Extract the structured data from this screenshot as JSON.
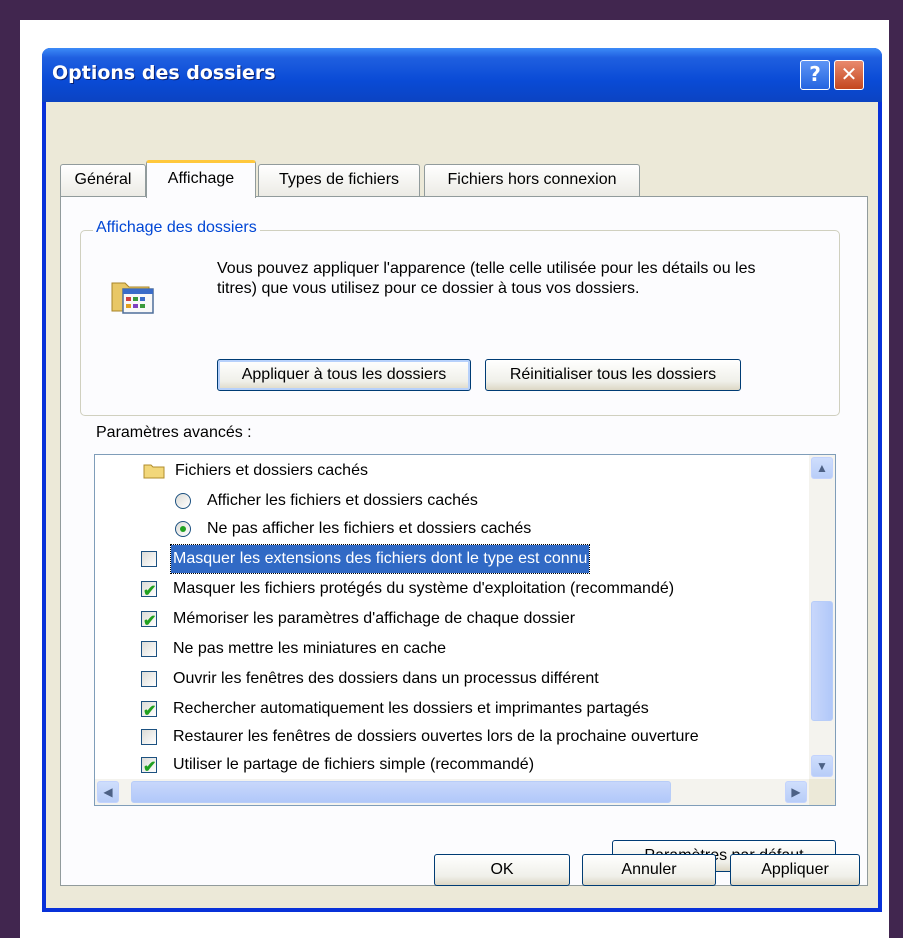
{
  "window": {
    "title": "Options des dossiers"
  },
  "tabs": [
    {
      "label": "Général"
    },
    {
      "label": "Affichage"
    },
    {
      "label": "Types de fichiers"
    },
    {
      "label": "Fichiers hors connexion"
    }
  ],
  "group": {
    "legend": "Affichage des dossiers",
    "description": "Vous pouvez appliquer l'apparence (telle celle utilisée pour les détails ou les titres) que vous utilisez pour ce dossier à tous vos dossiers.",
    "apply_all_label": "Appliquer à tous les dossiers",
    "reset_all_label": "Réinitialiser tous les dossiers"
  },
  "advanced": {
    "label": "Paramètres avancés :",
    "items": [
      {
        "kind": "folder",
        "text": "Fichiers et dossiers cachés"
      },
      {
        "kind": "radio",
        "checked": false,
        "text": "Afficher les fichiers et dossiers cachés"
      },
      {
        "kind": "radio",
        "checked": true,
        "text": "Ne pas afficher les fichiers et dossiers cachés"
      },
      {
        "kind": "checkbox",
        "checked": false,
        "selected": true,
        "text": "Masquer les extensions des fichiers dont le type est connu"
      },
      {
        "kind": "checkbox",
        "checked": true,
        "text": "Masquer les fichiers protégés du système d'exploitation (recommandé)"
      },
      {
        "kind": "checkbox",
        "checked": true,
        "text": "Mémoriser les paramètres d'affichage de chaque dossier"
      },
      {
        "kind": "checkbox",
        "checked": false,
        "text": "Ne pas mettre les miniatures en cache"
      },
      {
        "kind": "checkbox",
        "checked": false,
        "text": "Ouvrir les fenêtres des dossiers dans un processus différent"
      },
      {
        "kind": "checkbox",
        "checked": true,
        "text": "Rechercher automatiquement les dossiers et imprimantes partagés"
      },
      {
        "kind": "checkbox",
        "checked": false,
        "text": "Restaurer les fenêtres de dossiers ouvertes lors de la prochaine ouverture"
      },
      {
        "kind": "checkbox",
        "checked": true,
        "text": "Utiliser le partage de fichiers simple (recommandé)"
      }
    ]
  },
  "defaults_label": "Paramètres par défaut",
  "footer": {
    "ok_label": "OK",
    "cancel_label": "Annuler",
    "apply_label": "Appliquer"
  },
  "icons": {
    "help": "help-icon",
    "close": "close-icon",
    "folder_options": "folder-options-icon",
    "folder": "folder-icon"
  }
}
